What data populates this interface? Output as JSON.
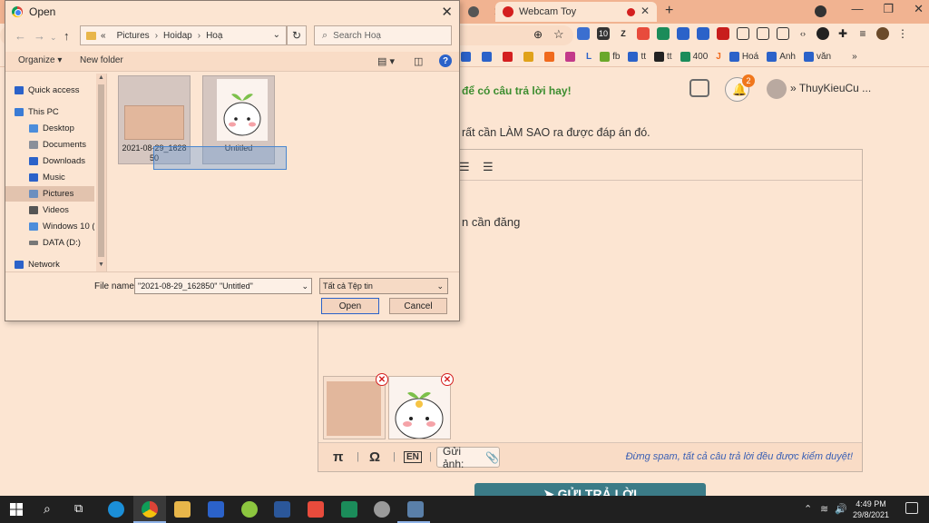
{
  "browser": {
    "tabs": [
      {
        "label": "Webcam Toy"
      }
    ],
    "bookmarks": [
      "fb",
      "tt",
      "tt",
      "400",
      "Hoá",
      "Anh",
      "văn"
    ]
  },
  "page": {
    "banner": "để có câu trả lời hay!",
    "notification_count": "2",
    "username": "ThuyKieuCu ...",
    "question_fragment": "rất cần LÀM SAO ra được đáp án đó.",
    "editor_text": "n cần đăng",
    "upload_label": "Gửi ảnh:",
    "warning": "Đừng spam, tất cả câu trả lời đều được kiểm duyệt!",
    "submit_label": "GỬI TRẢ LỜI"
  },
  "dialog": {
    "title": "Open",
    "breadcrumb": [
      "Pictures",
      "Hoidap",
      "Hoạ"
    ],
    "search_placeholder": "Search Hoạ",
    "organize_label": "Organize",
    "new_folder_label": "New folder",
    "nav_items": [
      {
        "label": "Quick access",
        "color": "#2b62c9"
      },
      {
        "label": "This PC",
        "color": "#3a7bd5"
      },
      {
        "label": "Desktop",
        "color": "#4c8ddb"
      },
      {
        "label": "Documents",
        "color": "#8a8f99"
      },
      {
        "label": "Downloads",
        "color": "#2b62c9"
      },
      {
        "label": "Music",
        "color": "#2b62c9"
      },
      {
        "label": "Pictures",
        "color": "#6b8fbf"
      },
      {
        "label": "Videos",
        "color": "#555555"
      },
      {
        "label": "Windows 10 (C",
        "color": "#4c8ddb"
      },
      {
        "label": "DATA (D:)",
        "color": "#777777"
      },
      {
        "label": "Network",
        "color": "#2b62c9"
      }
    ],
    "files": [
      {
        "name": "2021-08-29_1628 50"
      },
      {
        "name": "Untitled"
      }
    ],
    "file_name_label": "File name:",
    "file_name_value": "\"2021-08-29_162850\" \"Untitled\"",
    "file_type_value": "Tất cả Tệp tin",
    "open_label": "Open",
    "cancel_label": "Cancel"
  },
  "taskbar": {
    "time": "4:49 PM",
    "date": "29/8/2021"
  }
}
